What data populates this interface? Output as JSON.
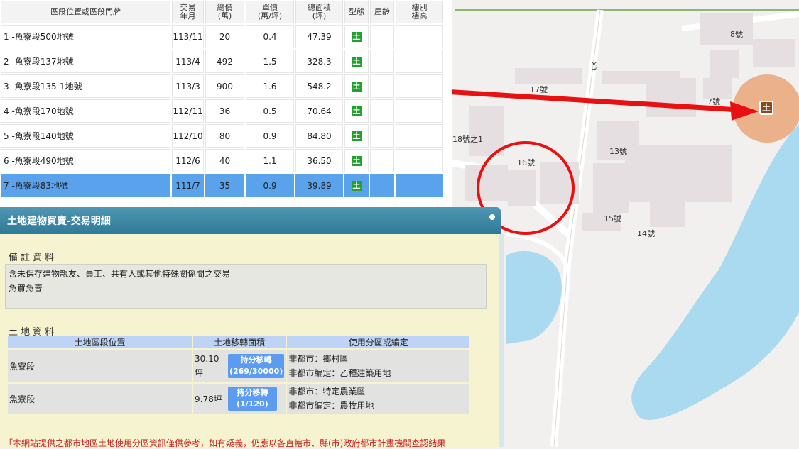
{
  "table": {
    "headers": [
      {
        "l1": "區段位置或區段門牌",
        "l2": ""
      },
      {
        "l1": "交易",
        "l2": "年月"
      },
      {
        "l1": "總價",
        "l2": "(萬)"
      },
      {
        "l1": "單價",
        "l2": "(萬/坪)"
      },
      {
        "l1": "總面積",
        "l2": "(坪)"
      },
      {
        "l1": "型態",
        "l2": ""
      },
      {
        "l1": "屋齡",
        "l2": ""
      },
      {
        "l1": "樓別",
        "l2": "樓高"
      }
    ],
    "rows": [
      {
        "loc": "1 -魚寮段500地號",
        "date": "113/11",
        "total": "20",
        "unit": "0.4",
        "area": "47.39",
        "type": "土"
      },
      {
        "loc": "2 -魚寮段137地號",
        "date": "113/4",
        "total": "492",
        "unit": "1.5",
        "area": "328.3",
        "type": "土"
      },
      {
        "loc": "3 -魚寮段135-1地號",
        "date": "113/3",
        "total": "900",
        "unit": "1.6",
        "area": "548.2",
        "type": "土"
      },
      {
        "loc": "4 -魚寮段170地號",
        "date": "112/11",
        "total": "36",
        "unit": "0.5",
        "area": "70.64",
        "type": "土"
      },
      {
        "loc": "5 -魚寮段140地號",
        "date": "112/10",
        "total": "80",
        "unit": "0.9",
        "area": "84.80",
        "type": "土"
      },
      {
        "loc": "6 -魚寮段490地號",
        "date": "112/6",
        "total": "40",
        "unit": "1.1",
        "area": "36.50",
        "type": "土"
      },
      {
        "loc": "7 -魚寮段83地號",
        "date": "111/7",
        "total": "35",
        "unit": "0.9",
        "area": "39.89",
        "type": "土"
      }
    ]
  },
  "panel": {
    "title": "土地建物買賣-交易明細",
    "remarks_title": "備註資料",
    "remarks": [
      "含未保存建物親友、員工、共有人或其他特殊關係間之交易",
      "急買急賣"
    ],
    "land_title": "土地資料",
    "land_headers": [
      "土地區段位置",
      "土地移轉面積",
      "使用分區或編定"
    ],
    "land_rows": [
      {
        "loc": "魚寮段",
        "area": "30.10坪",
        "share_label": "持分移轉",
        "share_ratio": "(269/30000)",
        "zone": "非都市：鄉村區",
        "use": "非都市編定：乙種建築用地"
      },
      {
        "loc": "魚寮段",
        "area": "9.78坪",
        "share_label": "持分移轉",
        "share_ratio": "(1/120)",
        "zone": "非都市：特定農業區",
        "use": "非都市編定：農牧用地"
      }
    ],
    "disclaimer": "「本網站提供之都市地區土地使用分區資訊僅供參考，如有疑義，仍應以各直轄市、縣(市)政府都市計畫機關查認結果"
  },
  "map": {
    "labels": [
      "8號",
      "17號",
      "7號",
      "18號之1",
      "16號",
      "13號",
      "15號",
      "14號",
      "X3"
    ],
    "marker_glyph": "土"
  },
  "colors": {
    "selected_row": "#5aa2ec",
    "type_badge": "#22a12e",
    "panel_header": "#3a86a4",
    "panel_bg": "#f6f3d0",
    "water": "#aadaf0",
    "annotation": "#e81010"
  }
}
